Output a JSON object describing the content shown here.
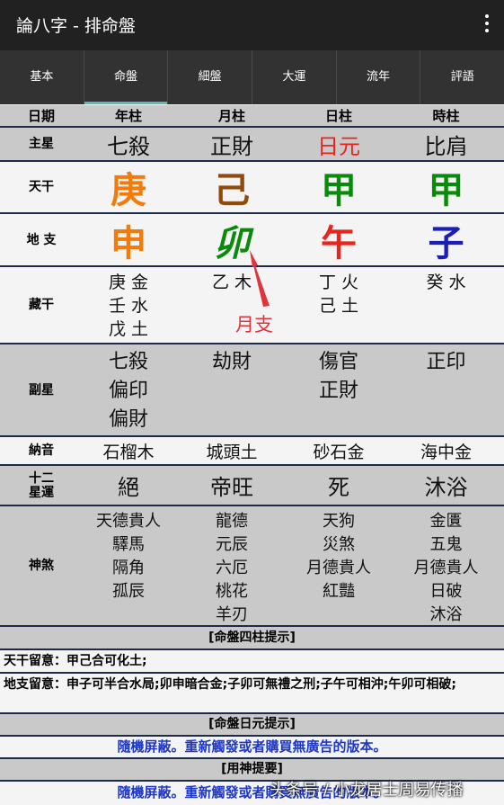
{
  "app": {
    "title": "論八字 - 排命盤"
  },
  "tabs": [
    "基本",
    "命盤",
    "細盤",
    "大運",
    "流年",
    "評語"
  ],
  "active_tab": 1,
  "header": {
    "label": "日期",
    "cols": [
      "年柱",
      "月柱",
      "日柱",
      "時柱"
    ]
  },
  "zhuxing": {
    "label": "主星",
    "cols": [
      "七殺",
      "正財",
      "日元",
      "比肩"
    ],
    "colors": [
      "#111111",
      "#111111",
      "#e8241e",
      "#111111"
    ]
  },
  "tiangan": {
    "label": "天干",
    "cols": [
      "庚",
      "己",
      "甲",
      "甲"
    ],
    "colors": [
      "#f27b0c",
      "#8f4a0c",
      "#0a8a0a",
      "#0a8a0a"
    ]
  },
  "dizhi": {
    "label": "地 支",
    "cols": [
      "申",
      "卯",
      "午",
      "子"
    ],
    "colors": [
      "#f27b0c",
      "#0a8a0a",
      "#e8241e",
      "#1b1fb8"
    ]
  },
  "canggan": {
    "label": "藏干",
    "cols": [
      [
        "庚 金",
        "壬 水",
        "戊 土"
      ],
      [
        "乙 木"
      ],
      [
        "丁 火",
        "己 土"
      ],
      [
        "癸 水"
      ]
    ]
  },
  "annotation": {
    "text": "月支"
  },
  "fuxing": {
    "label": "副星",
    "cols": [
      [
        "七殺",
        "偏印",
        "偏財"
      ],
      [
        "劫財"
      ],
      [
        "傷官",
        "正財"
      ],
      [
        "正印"
      ]
    ]
  },
  "nayin": {
    "label": "納音",
    "cols": [
      "石榴木",
      "城頭土",
      "砂石金",
      "海中金"
    ]
  },
  "shier": {
    "label": "十二星運",
    "cols": [
      "絕",
      "帝旺",
      "死",
      "沐浴"
    ]
  },
  "shensha": {
    "label": "神煞",
    "cols": [
      [
        "天德貴人",
        "驛馬",
        "隔角",
        "孤辰"
      ],
      [
        "龍德",
        "元辰",
        "六厄",
        "桃花",
        "羊刃"
      ],
      [
        "天狗",
        "災煞",
        "月德貴人",
        "紅豔"
      ],
      [
        "金匱",
        "五鬼",
        "月德貴人",
        "日破",
        "沐浴"
      ]
    ]
  },
  "sections": {
    "pillars_title": "[命盤四柱提示]",
    "tiangan_note": "天干留意：甲己合可化土;",
    "dizhi_note": "地支留意：申子可半合水局;卯申暗合金;子卯可無禮之刑;子午可相沖;午卯可相破;",
    "riyuan_title": "[命盤日元提示]",
    "blocked_msg": "隨機屏蔽。重新觸發或者購買無廣告的版本。",
    "yongshen_title": "[用神提要]",
    "blocked_msg2": "隨機屏蔽。重新觸發或者購買無廣告的版本。"
  },
  "watermark": "头条号 / 小龙居士周易传播"
}
